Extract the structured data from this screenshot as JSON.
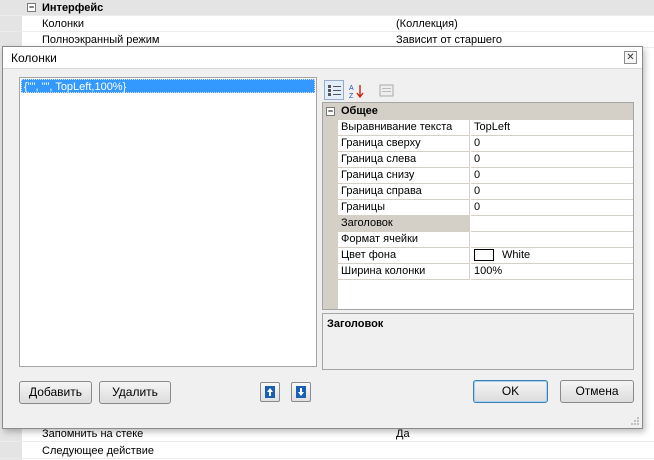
{
  "background": {
    "rows": [
      {
        "name": "Интерфейс",
        "value": "",
        "category": true
      },
      {
        "name": "Колонки",
        "value": "(Коллекция)"
      },
      {
        "name": "Полноэкранный режим",
        "value": "Зависит от старшего"
      },
      {
        "name": "Запомнить на стеке",
        "value": "Да"
      },
      {
        "name": "Следующее действие",
        "value": ""
      }
    ]
  },
  "dialog": {
    "title": "Колонки",
    "close_glyph": "✕",
    "list": {
      "items": [
        "{\"\", \"\", TopLeft,100%}"
      ]
    },
    "property_grid": {
      "category": "Общее",
      "rows": [
        {
          "name": "Выравнивание текста",
          "value": "TopLeft"
        },
        {
          "name": "Граница сверху",
          "value": "0"
        },
        {
          "name": "Граница слева",
          "value": "0"
        },
        {
          "name": "Граница снизу",
          "value": "0"
        },
        {
          "name": "Граница справа",
          "value": "0"
        },
        {
          "name": "Границы",
          "value": "0"
        },
        {
          "name": "Заголовок",
          "value": ""
        },
        {
          "name": "Формат ячейки",
          "value": ""
        },
        {
          "name": "Цвет фона",
          "value": "White"
        },
        {
          "name": "Ширина колонки",
          "value": "100%"
        }
      ],
      "selected_row": "Заголовок"
    },
    "description": {
      "title": "Заголовок"
    },
    "buttons": {
      "add": "Добавить",
      "delete": "Удалить",
      "ok": "OK",
      "cancel": "Отмена"
    }
  },
  "icons": {
    "categorized": "categorized-view-icon",
    "alphabetical": "alphabetical-sort-icon",
    "property_pages": "property-pages-icon",
    "move_up": "move-up-icon",
    "move_down": "move-down-icon"
  },
  "colors": {
    "selection": "#3399ff",
    "annotation_underline": "#e41e26",
    "category_bg": "#d4d0c8"
  }
}
